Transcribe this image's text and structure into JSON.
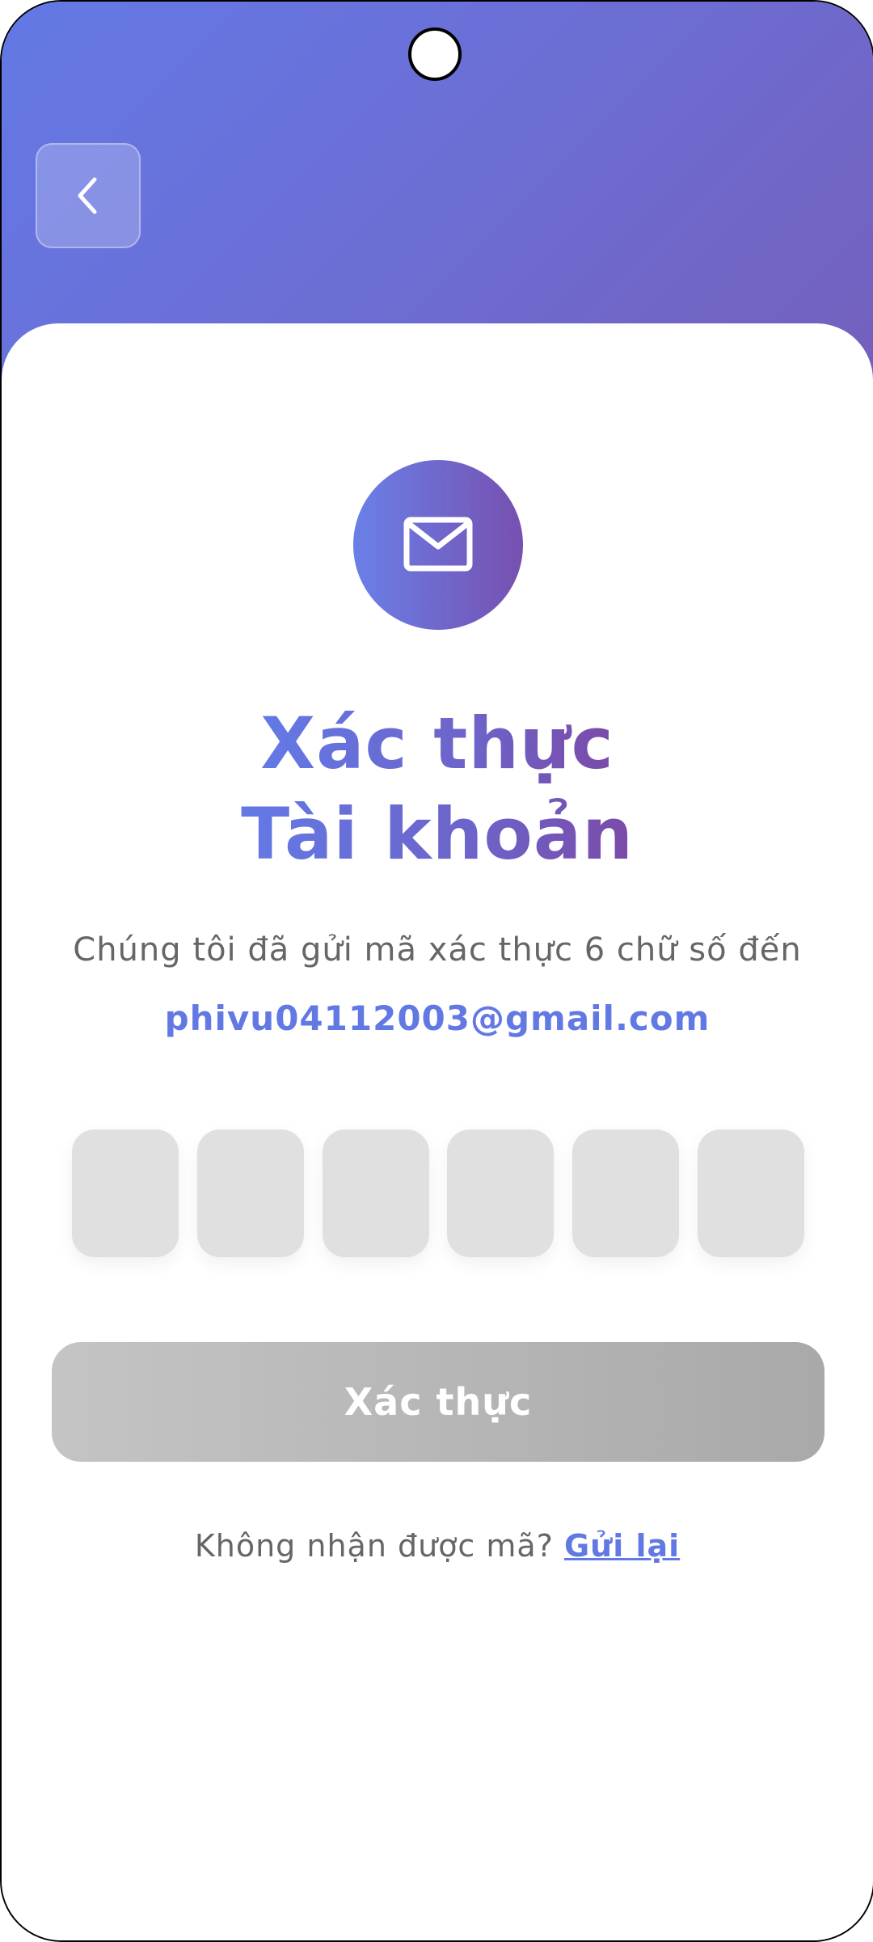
{
  "colors": {
    "accent": "#6279e3",
    "accent_end": "#7650b0",
    "button_disabled": "#b5b5b5",
    "otp_box": "#e0e0e0",
    "text_muted": "#666666"
  },
  "header": {
    "back_icon": "chevron-left-icon"
  },
  "hero": {
    "icon": "mail-icon",
    "title_line1": "Xác thực",
    "title_line2": "Tài khoản"
  },
  "message": {
    "text": "Chúng tôi đã gửi mã xác thực 6 chữ số đến",
    "email": "phivu04112003@gmail.com"
  },
  "otp": {
    "digits": [
      "",
      "",
      "",
      "",
      "",
      ""
    ]
  },
  "actions": {
    "verify_label": "Xác thực"
  },
  "resend": {
    "prompt": "Không nhận được mã?",
    "link_label": "Gửi lại"
  }
}
